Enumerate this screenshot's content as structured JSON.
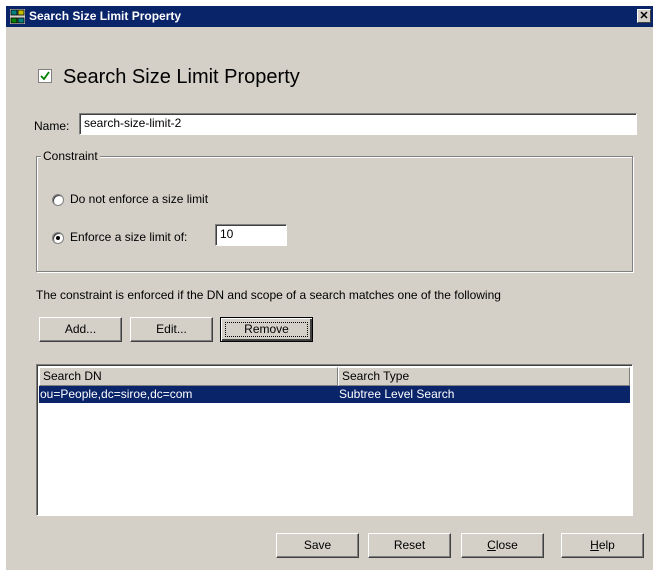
{
  "window": {
    "title": "Search Size Limit Property",
    "close_glyph": "✕"
  },
  "header": {
    "title": "Search Size Limit Property",
    "checked": true
  },
  "form": {
    "name_label": "Name:",
    "name_value": "search-size-limit-2"
  },
  "constraint": {
    "legend": "Constraint",
    "option_no_limit": "Do not enforce a size limit",
    "option_limit": "Enforce a size limit of:",
    "selected": "option_limit",
    "limit_value": "10"
  },
  "description": "The constraint is enforced if the DN and scope of a search matches one of the following",
  "list_buttons": {
    "add": "Add...",
    "edit": "Edit...",
    "remove": "Remove"
  },
  "table": {
    "columns": [
      "Search DN",
      "Search Type"
    ],
    "rows": [
      {
        "dn": "ou=People,dc=siroe,dc=com",
        "type": "Subtree Level Search",
        "selected": true
      }
    ]
  },
  "footer": {
    "save": "Save",
    "reset": "Reset",
    "close_prefix": "",
    "close_mnemonic": "C",
    "close_rest": "lose",
    "help_prefix": "",
    "help_mnemonic": "H",
    "help_rest": "elp"
  },
  "colors": {
    "titlebar": "#0a246a",
    "dialog_bg": "#d4d0c8",
    "selection": "#0a246a",
    "checkmark": "#008000"
  }
}
